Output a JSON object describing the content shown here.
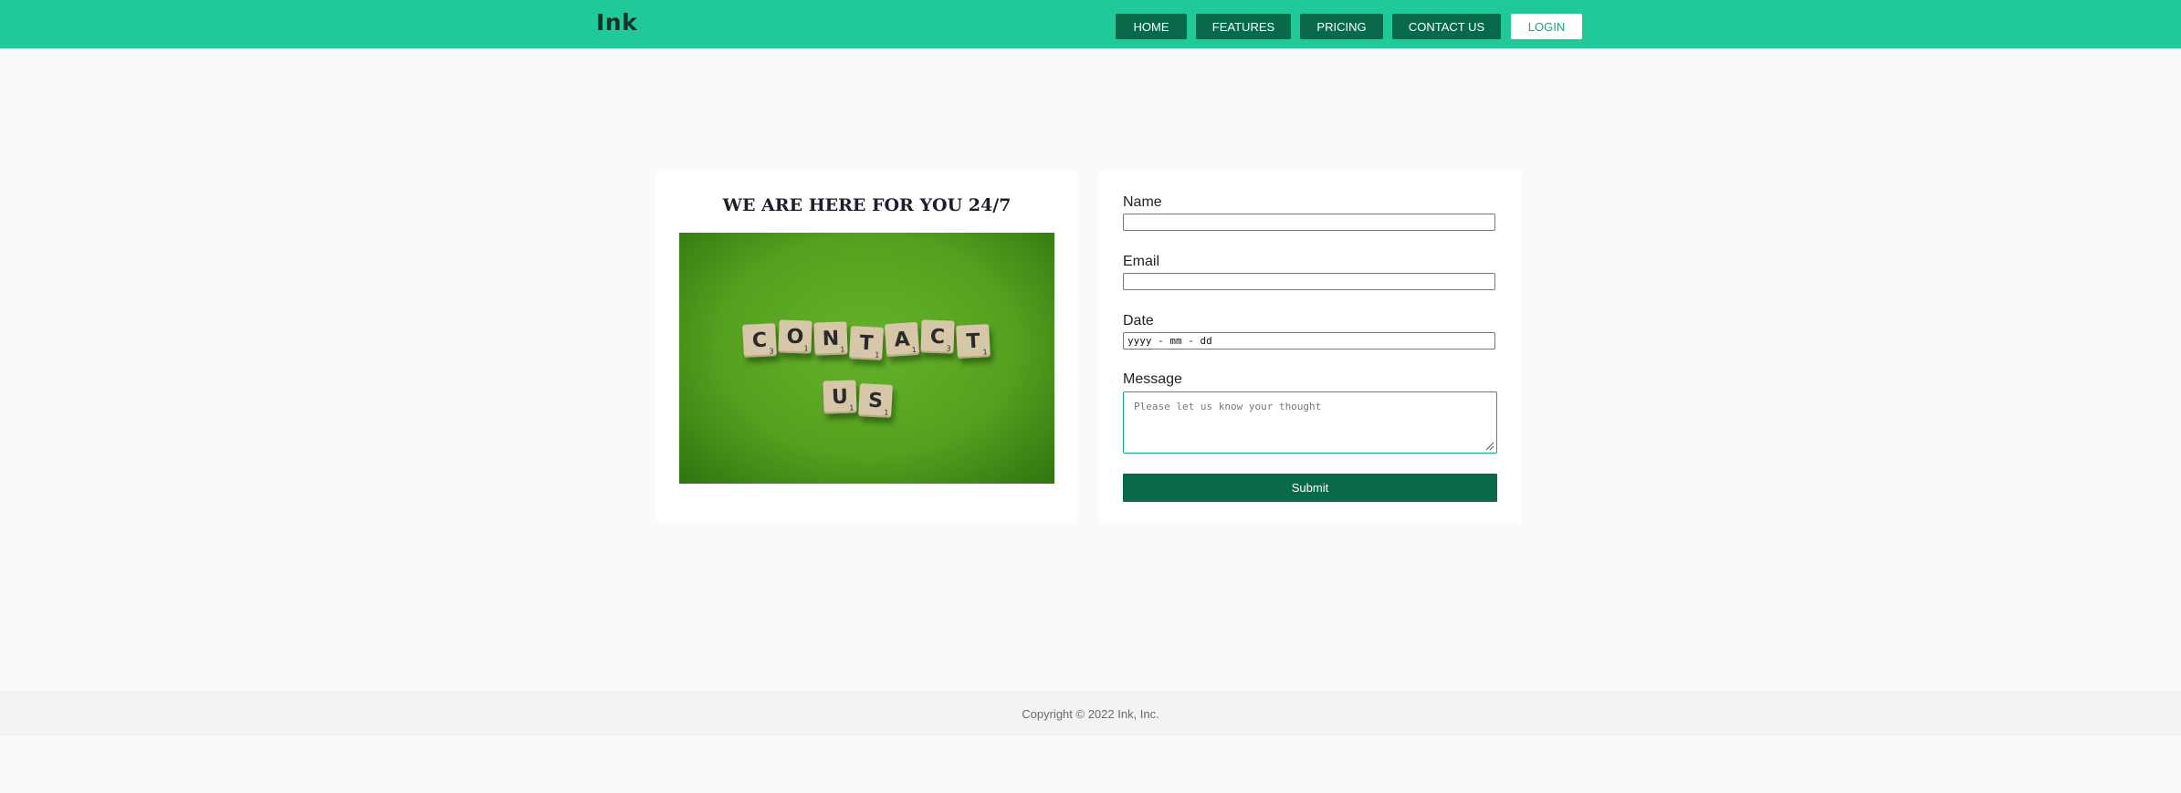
{
  "header": {
    "logo": "Ink",
    "nav": [
      {
        "label": "HOME"
      },
      {
        "label": "FEATURES"
      },
      {
        "label": "PRICING"
      },
      {
        "label": "CONTACT US"
      },
      {
        "label": "LOGIN"
      }
    ]
  },
  "contact_card": {
    "title": "WE ARE HERE FOR YOU 24/7",
    "image_tiles": {
      "row1": [
        "C",
        "O",
        "N",
        "T",
        "A",
        "C",
        "T"
      ],
      "row1_scores": [
        "3",
        "1",
        "1",
        "1",
        "1",
        "3",
        "1"
      ],
      "row2": [
        "U",
        "S"
      ],
      "row2_scores": [
        "1",
        "1"
      ]
    }
  },
  "form": {
    "name_label": "Name",
    "name_value": "",
    "email_label": "Email",
    "email_value": "",
    "date_label": "Date",
    "date_value": "yyyy - mm - dd",
    "message_label": "Message",
    "message_placeholder": "Please let us know your thought",
    "submit_label": "Submit"
  },
  "footer": {
    "copyright": "Copyright © 2022 Ink, Inc."
  },
  "colors": {
    "header_bg": "#20c997",
    "nav_bg": "#086a4b",
    "login_text": "#18a57b",
    "submit_bg": "#086a4b",
    "page_bg": "#f9fafb",
    "footer_bg": "#f2f3f4"
  }
}
